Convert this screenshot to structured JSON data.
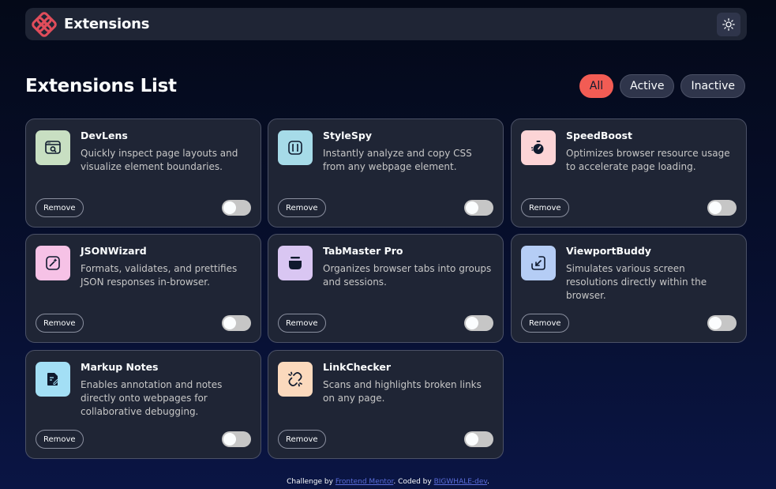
{
  "header": {
    "brand": "Extensions",
    "logo_icon": "extensions-logo-icon",
    "theme_icon": "sun-icon",
    "accent": "#f25c54"
  },
  "main": {
    "title": "Extensions List",
    "filters": [
      {
        "label": "All",
        "selected": true
      },
      {
        "label": "Active",
        "selected": false
      },
      {
        "label": "Inactive",
        "selected": false
      }
    ]
  },
  "extensions": [
    {
      "name": "DevLens",
      "description": "Quickly inspect page layouts and visualize element boundaries.",
      "icon": "inspect-window-icon",
      "color": "#c8dfc2",
      "remove": "Remove",
      "enabled": false
    },
    {
      "name": "StyleSpy",
      "description": "Instantly analyze and copy CSS from any webpage element.",
      "icon": "code-brackets-icon",
      "color": "#a6dbe8",
      "remove": "Remove",
      "enabled": false
    },
    {
      "name": "SpeedBoost",
      "description": "Optimizes browser resource usage to accelerate page loading.",
      "icon": "stopwatch-icon",
      "color": "#fcd4d6",
      "remove": "Remove",
      "enabled": false
    },
    {
      "name": "JSONWizard",
      "description": "Formats, validates, and prettifies JSON responses in-browser.",
      "icon": "wand-icon",
      "color": "#f6c2e6",
      "remove": "Remove",
      "enabled": false
    },
    {
      "name": "TabMaster Pro",
      "description": "Organizes browser tabs into groups and sessions.",
      "icon": "stacked-tabs-icon",
      "color": "#d9c6f2",
      "remove": "Remove",
      "enabled": false
    },
    {
      "name": "ViewportBuddy",
      "description": "Simulates various screen resolutions directly within the browser.",
      "icon": "resize-arrow-icon",
      "color": "#b5cdf5",
      "remove": "Remove",
      "enabled": false
    },
    {
      "name": "Markup Notes",
      "description": "Enables annotation and notes directly onto webpages for collaborative debugging.",
      "icon": "note-pen-icon",
      "color": "#a3dff5",
      "remove": "Remove",
      "enabled": false
    },
    {
      "name": "LinkChecker",
      "description": "Scans and highlights broken links on any page.",
      "icon": "broken-link-icon",
      "color": "#fbd9bd",
      "remove": "Remove",
      "enabled": false
    }
  ],
  "footer": {
    "prefix": "Challenge by",
    "link1": "Frontend Mentor",
    "middle": ". Coded by",
    "link2": "BIGWHALE-dev",
    "suffix": "."
  }
}
